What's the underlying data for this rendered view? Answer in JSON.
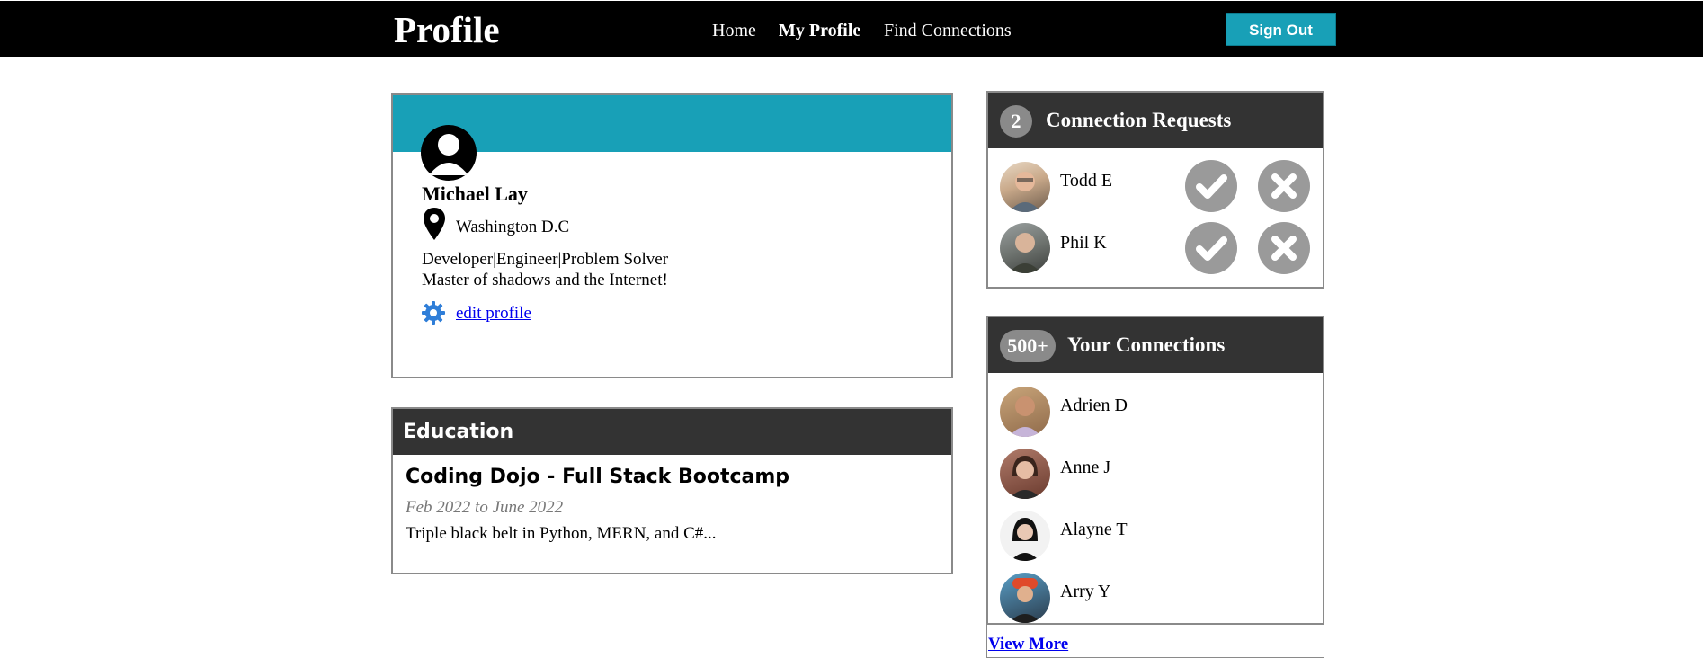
{
  "header": {
    "brand": "Profile",
    "nav": [
      {
        "label": "Home"
      },
      {
        "label": "My Profile"
      },
      {
        "label": "Find Connections"
      }
    ],
    "sign_out_label": "Sign Out"
  },
  "profile": {
    "name": "Michael Lay",
    "location": "Washington D.C",
    "title": "Developer|Engineer|Problem Solver",
    "bio": "Master of shadows and the Internet!",
    "edit_label": "edit profile",
    "avatar_icon": "user-avatar-icon",
    "location_icon": "map-pin-icon",
    "edit_icon": "gear-icon"
  },
  "education": {
    "heading": "Education",
    "school": "Coding Dojo - Full Stack Bootcamp",
    "dates": "Feb 2022 to June 2022",
    "description": "Triple black belt in Python, MERN, and C#..."
  },
  "requests": {
    "count": "2",
    "title": "Connection Requests",
    "items": [
      {
        "name": "Todd E",
        "accept_icon": "check-icon",
        "decline_icon": "x-icon"
      },
      {
        "name": "Phil K",
        "accept_icon": "check-icon",
        "decline_icon": "x-icon"
      }
    ]
  },
  "connections": {
    "count": "500+",
    "title": "Your Connections",
    "items": [
      {
        "name": "Adrien D"
      },
      {
        "name": "Anne J"
      },
      {
        "name": "Alayne T"
      },
      {
        "name": "Arry Y"
      }
    ],
    "view_more_label": "View More"
  },
  "colors": {
    "accent": "#18a0b7",
    "header_bg": "#000000",
    "panel_head": "#333333",
    "badge": "#8a8a8a",
    "action_button": "#9a9a9a",
    "link": "#0000ee",
    "gear": "#2f7ed8"
  }
}
